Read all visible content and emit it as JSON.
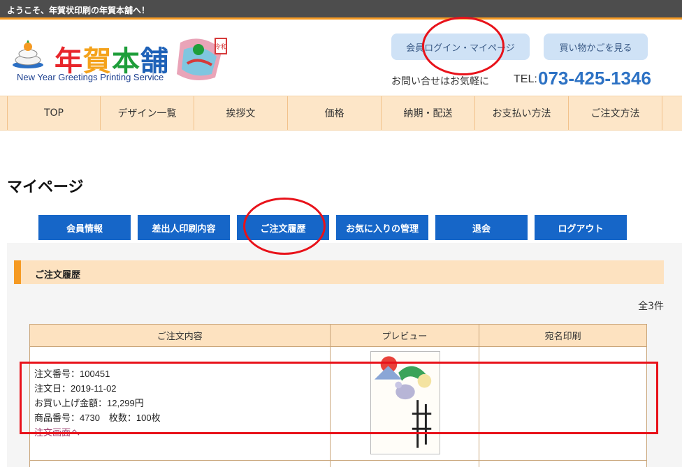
{
  "topbar": {
    "welcome": "ようこそ、年賀状印刷の年賀本舗へ！"
  },
  "header": {
    "logo_title": "年賀本舗",
    "logo_subtitle": "New Year Greetings Printing Service",
    "login_button": "会員ログイン・マイページ",
    "cart_button": "買い物かごを見る",
    "contact_label": "お問い合せはお気軽に",
    "tel_prefix": "TEL:",
    "tel": "073-425-1346"
  },
  "nav": {
    "items": [
      "TOP",
      "デザイン一覧",
      "挨拶文",
      "価格",
      "納期・配送",
      "お支払い方法",
      "ご注文方法"
    ]
  },
  "page": {
    "title": "マイページ"
  },
  "tabs": {
    "items": [
      "会員情報",
      "差出人印刷内容",
      "ご注文履歴",
      "お気に入りの管理",
      "退会",
      "ログアウト"
    ]
  },
  "section": {
    "title": "ご注文履歴",
    "count": "全3件"
  },
  "table": {
    "headers": [
      "ご注文内容",
      "プレビュー",
      "宛名印刷"
    ],
    "rows": [
      {
        "order_no": "注文番号：100451",
        "order_date": "注文日：2019-11-02",
        "amount": "お買い上げ金額：12,299円",
        "product": "商品番号：4730　枚数：100枚",
        "link": "注文画面へ",
        "address_print": ""
      }
    ]
  },
  "colors": {
    "accent": "#f59a23",
    "tab_blue": "#1666c8",
    "tel_blue": "#2d72c4",
    "annotation": "#e8121a"
  }
}
